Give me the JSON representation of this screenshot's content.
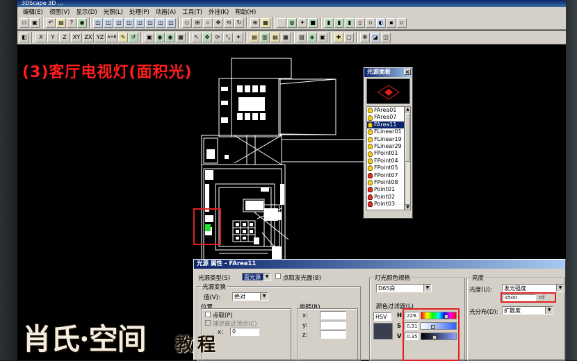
{
  "app": {
    "title": "3DScape 3D ..."
  },
  "menu": [
    "编辑(E)",
    "视图(V)",
    "显示(D)",
    "光照(L)",
    "处理(P)",
    "动画(A)",
    "工具(T)",
    "外挂(K)",
    "帮助(H)"
  ],
  "axis_buttons": [
    "X",
    "Y",
    "Z",
    "XY",
    "ZX",
    "YZ",
    "A+B"
  ],
  "heading": "(3)客厅电视灯(面积光)",
  "light_panel": {
    "title": "光源面板",
    "close": "×",
    "items": [
      {
        "name": "FArea01",
        "icon": "yellow-bulb-icon"
      },
      {
        "name": "FArea07",
        "icon": "yellow-bulb-icon"
      },
      {
        "name": "FArea11",
        "icon": "yellow-bulb-icon",
        "selected": true
      },
      {
        "name": "FLinear01",
        "icon": "yellow-bulb-icon"
      },
      {
        "name": "FLinear19",
        "icon": "yellow-bulb-icon"
      },
      {
        "name": "FLinear29",
        "icon": "yellow-bulb-icon"
      },
      {
        "name": "FPoint01",
        "icon": "yellow-bulb-icon"
      },
      {
        "name": "FPoint04",
        "icon": "yellow-bulb-icon"
      },
      {
        "name": "FPoint05",
        "icon": "yellow-bulb-icon"
      },
      {
        "name": "FPoint07",
        "icon": "red-bulb-icon"
      },
      {
        "name": "FPoint08",
        "icon": "yellow-bulb-icon"
      },
      {
        "name": "Point01",
        "icon": "red-bulb-icon"
      },
      {
        "name": "Point02",
        "icon": "red-bulb-icon"
      },
      {
        "name": "Point03",
        "icon": "red-bulb-icon"
      }
    ]
  },
  "props": {
    "title": "光源 属性 - FArea11",
    "source_type_label": "光源类型(S)",
    "source_type_value": "面光源",
    "hide_source_label": "点取发光面(B)",
    "transform_group": "光源变换",
    "value_label": "值(V):",
    "value_value": "绝对",
    "position_group": "位置",
    "pick_label": "点取(P)",
    "snap_label": "捕捉最近顶点(C)",
    "x_label": "x:",
    "x_value": "0",
    "rotation_group": "旋转(R)",
    "rx_label": "x:",
    "ry_label": "y:",
    "rz_label": "z:",
    "color_group": "灯光颜色规格",
    "color_spec_value": "D65白",
    "color_filter_label": "颜色过滤器(L)",
    "color_model": "HSV",
    "h_label": "H",
    "h_value": "229.",
    "s_label": "S",
    "s_value": "0.31",
    "v_label": "V",
    "v_value": "0.35",
    "brightness_group": "亮度",
    "luminosity_label": "光度(U):",
    "luminosity_type": "发光强度",
    "intensity_value": "4500",
    "intensity_unit": "cd",
    "distribution_label": "光分布(D):",
    "distribution_value": "扩散度"
  },
  "watermark": {
    "logo": "肖氏·空间",
    "sub": "教程"
  },
  "colors": {
    "heading": "#ff1e1e",
    "highlight": "#e02020",
    "selection": "#0a246a"
  }
}
